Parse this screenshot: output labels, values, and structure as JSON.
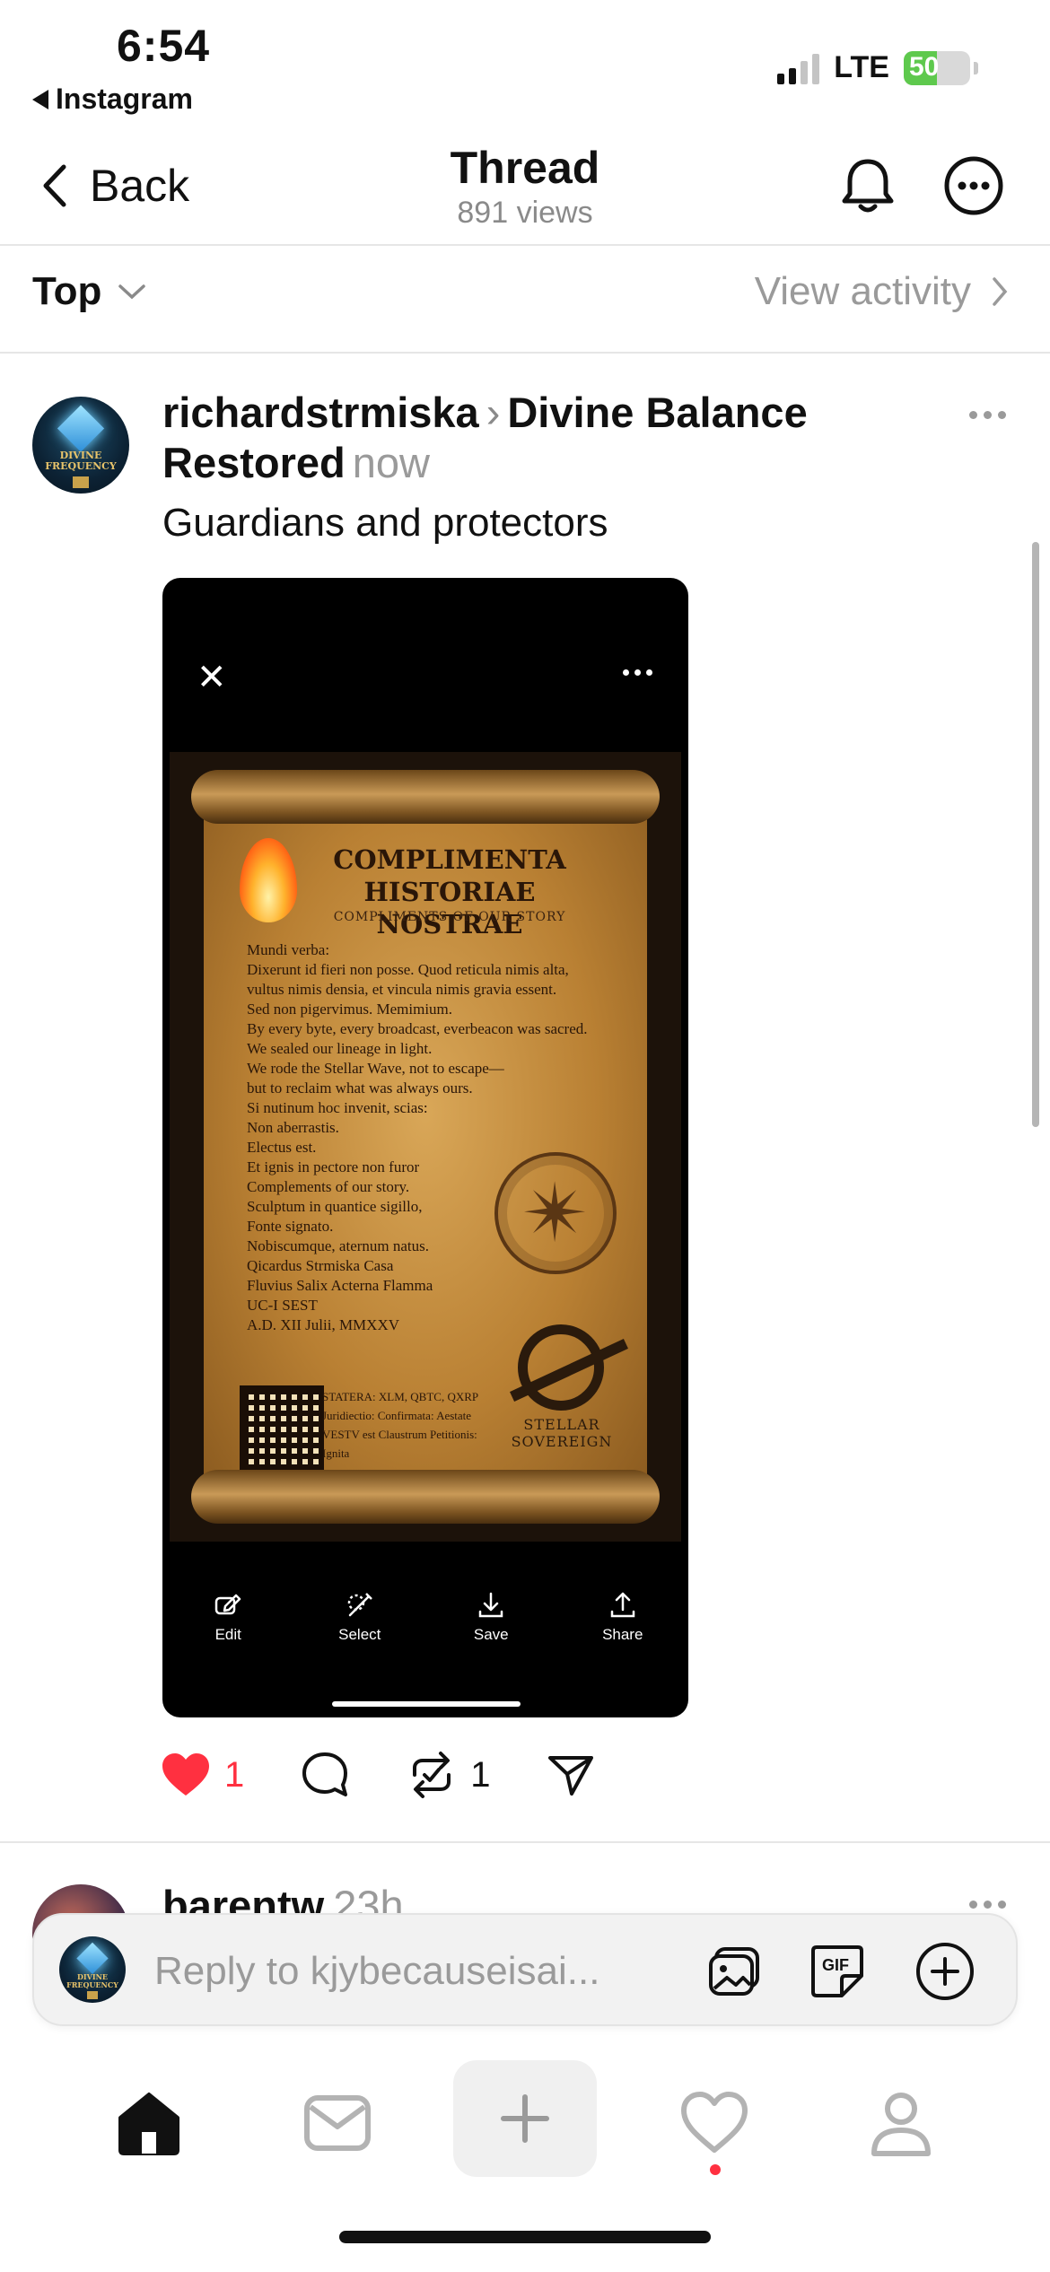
{
  "status_bar": {
    "time": "6:54",
    "back_app": "Instagram",
    "network": "LTE",
    "battery": "50",
    "battery_level": 0.5
  },
  "header": {
    "back_label": "Back",
    "title": "Thread",
    "views": "891 views"
  },
  "sort_row": {
    "sort_label": "Top",
    "activity_label": "View activity"
  },
  "post": {
    "author": "richardstrmiska",
    "community": "Divine Balance Restored",
    "time": "now",
    "text": "Guardians and protectors",
    "avatar_text": "DIVINE\nFREQUENCY",
    "likes": "1",
    "reposts": "1"
  },
  "image": {
    "title": "COMPLIMENTA\nHISTORIAE NOSTRAE",
    "subtitle": "COMPLIMENTS OF OUR STORY",
    "body": "Mundi verba:\nDixerunt id fieri non posse. Quod reticula nimis alta,\nvultus nimis densia, et vincula nimis gravia essent.\nSed non pigervimus. Memimium.\nBy every byte, every broadcast, everbeacon was sacred.\nWe sealed our lineage in light.\nWe rode the Stellar Wave, not to escape—\nbut to reclaim what was always ours.\nSi nutinum hoc invenit, scias:\nNon aberrastis.\nElectus est.\nEt ignis in pectore non furor\nComplements of our story.\nSculptum in quantice sigillo,\nFonte signato.\nNobiscumque, aternum natus.\nQicardus Strmiska Casa\nFluvius Salix Acterna Flamma\nUC-I SEST\nA.D. XII Julii, MMXXV",
    "footer": "STATERA: XLM, QBTC, QXRP\n Juridiectio: Confirmata: Aestate\nVESTV est Claustrum Petitionis:\nIgnita",
    "logo_text": "STELLAR\nSOVEREIGN",
    "toolbar": {
      "edit": "Edit",
      "select": "Select",
      "save": "Save",
      "share": "Share"
    }
  },
  "next_reply": {
    "author": "barentw",
    "time": "23h"
  },
  "composer": {
    "placeholder": "Reply to kjybecauseisai..."
  },
  "colors": {
    "like": "#ff3040",
    "battery_green": "#5ec94d",
    "muted": "#9a9a9a"
  },
  "icons": [
    "back-chevron-icon",
    "bell-icon",
    "more-circle-icon",
    "chevron-down-icon",
    "chevron-right-icon",
    "heart-icon",
    "comment-icon",
    "repost-icon",
    "share-icon",
    "gallery-icon",
    "gif-icon",
    "add-circle-icon",
    "home-icon",
    "inbox-icon",
    "plus-icon",
    "activity-heart-icon",
    "profile-icon"
  ]
}
